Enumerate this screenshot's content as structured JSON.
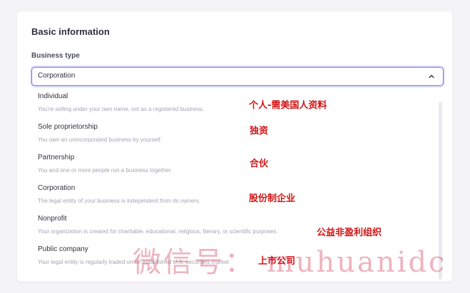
{
  "form": {
    "section_title": "Basic information",
    "field_label": "Business type",
    "selected_value": "Corporation",
    "chevron_icon": "chevron-up-icon"
  },
  "options": [
    {
      "title": "Individual",
      "description": "You're selling under your own name, not as a registered business."
    },
    {
      "title": "Sole proprietorship",
      "description": "You own an unincorporated business by yourself."
    },
    {
      "title": "Partnership",
      "description": "You and one or more people run a business together."
    },
    {
      "title": "Corporation",
      "description": "The legal entity of your business is independent from its owners."
    },
    {
      "title": "Nonprofit",
      "description": "Your organization is created for charitable, educational, religious, literary, or scientific purposes."
    },
    {
      "title": "Public company",
      "description": "Your legal entity is regularly traded on an established U.S. securities market"
    }
  ],
  "annotations": [
    "个人-需美国人资料",
    "独资",
    "合伙",
    "股份制企业",
    "公益非盈利组织",
    "上市公司"
  ],
  "watermark": "微信号： muhuanidc",
  "colors": {
    "accent": "#6b6fe8",
    "annotation": "#d21414"
  }
}
